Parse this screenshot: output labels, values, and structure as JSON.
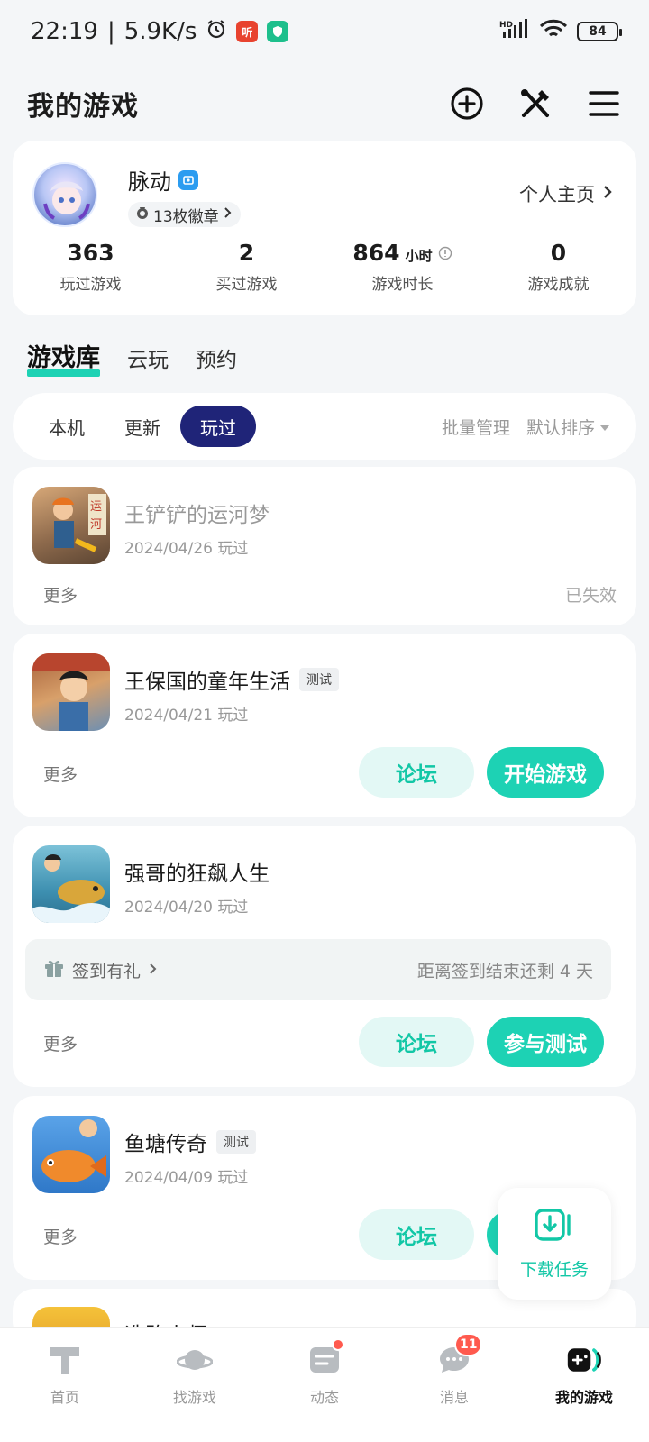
{
  "status_bar": {
    "time": "22:19",
    "speed": "5.9K/s",
    "battery": "84",
    "network": "HD"
  },
  "header": {
    "title": "我的游戏"
  },
  "profile": {
    "username": "脉动",
    "medals": "13枚徽章",
    "homepage_label": "个人主页",
    "stats": [
      {
        "value": "363",
        "unit": "",
        "label": "玩过游戏"
      },
      {
        "value": "2",
        "unit": "",
        "label": "买过游戏"
      },
      {
        "value": "864",
        "unit": "小时",
        "label": "游戏时长"
      },
      {
        "value": "0",
        "unit": "",
        "label": "游戏成就"
      }
    ]
  },
  "main_tabs": [
    "游戏库",
    "云玩",
    "预约"
  ],
  "filter": {
    "chips": [
      "本机",
      "更新",
      "玩过"
    ],
    "active_chip": "玩过",
    "batch_manage": "批量管理",
    "sort": "默认排序"
  },
  "games": [
    {
      "name": "王铲铲的运河梦",
      "date": "2024/04/26 玩过",
      "more": "更多",
      "status": "已失效"
    },
    {
      "name": "王保国的童年生活",
      "badge": "测试",
      "date": "2024/04/21 玩过",
      "more": "更多",
      "forum": "论坛",
      "primary": "开始游戏"
    },
    {
      "name": "强哥的狂飙人生",
      "date": "2024/04/20 玩过",
      "more": "更多",
      "forum": "论坛",
      "primary": "参与测试",
      "signin": "签到有礼",
      "signin_info": "距离签到结束还剩 4 天"
    },
    {
      "name": "鱼塘传奇",
      "badge": "测试",
      "date": "2024/04/09 玩过",
      "more": "更多",
      "forum": "论坛"
    },
    {
      "name": "造路小师"
    }
  ],
  "download_fab": {
    "label": "下载任务"
  },
  "bottom_nav": [
    {
      "label": "首页"
    },
    {
      "label": "找游戏"
    },
    {
      "label": "动态"
    },
    {
      "label": "消息",
      "count": "11"
    },
    {
      "label": "我的游戏"
    }
  ],
  "colors": {
    "accent": "#1dd2b4",
    "active_chip": "#1f2478",
    "badge_red": "#ff5a4e"
  }
}
